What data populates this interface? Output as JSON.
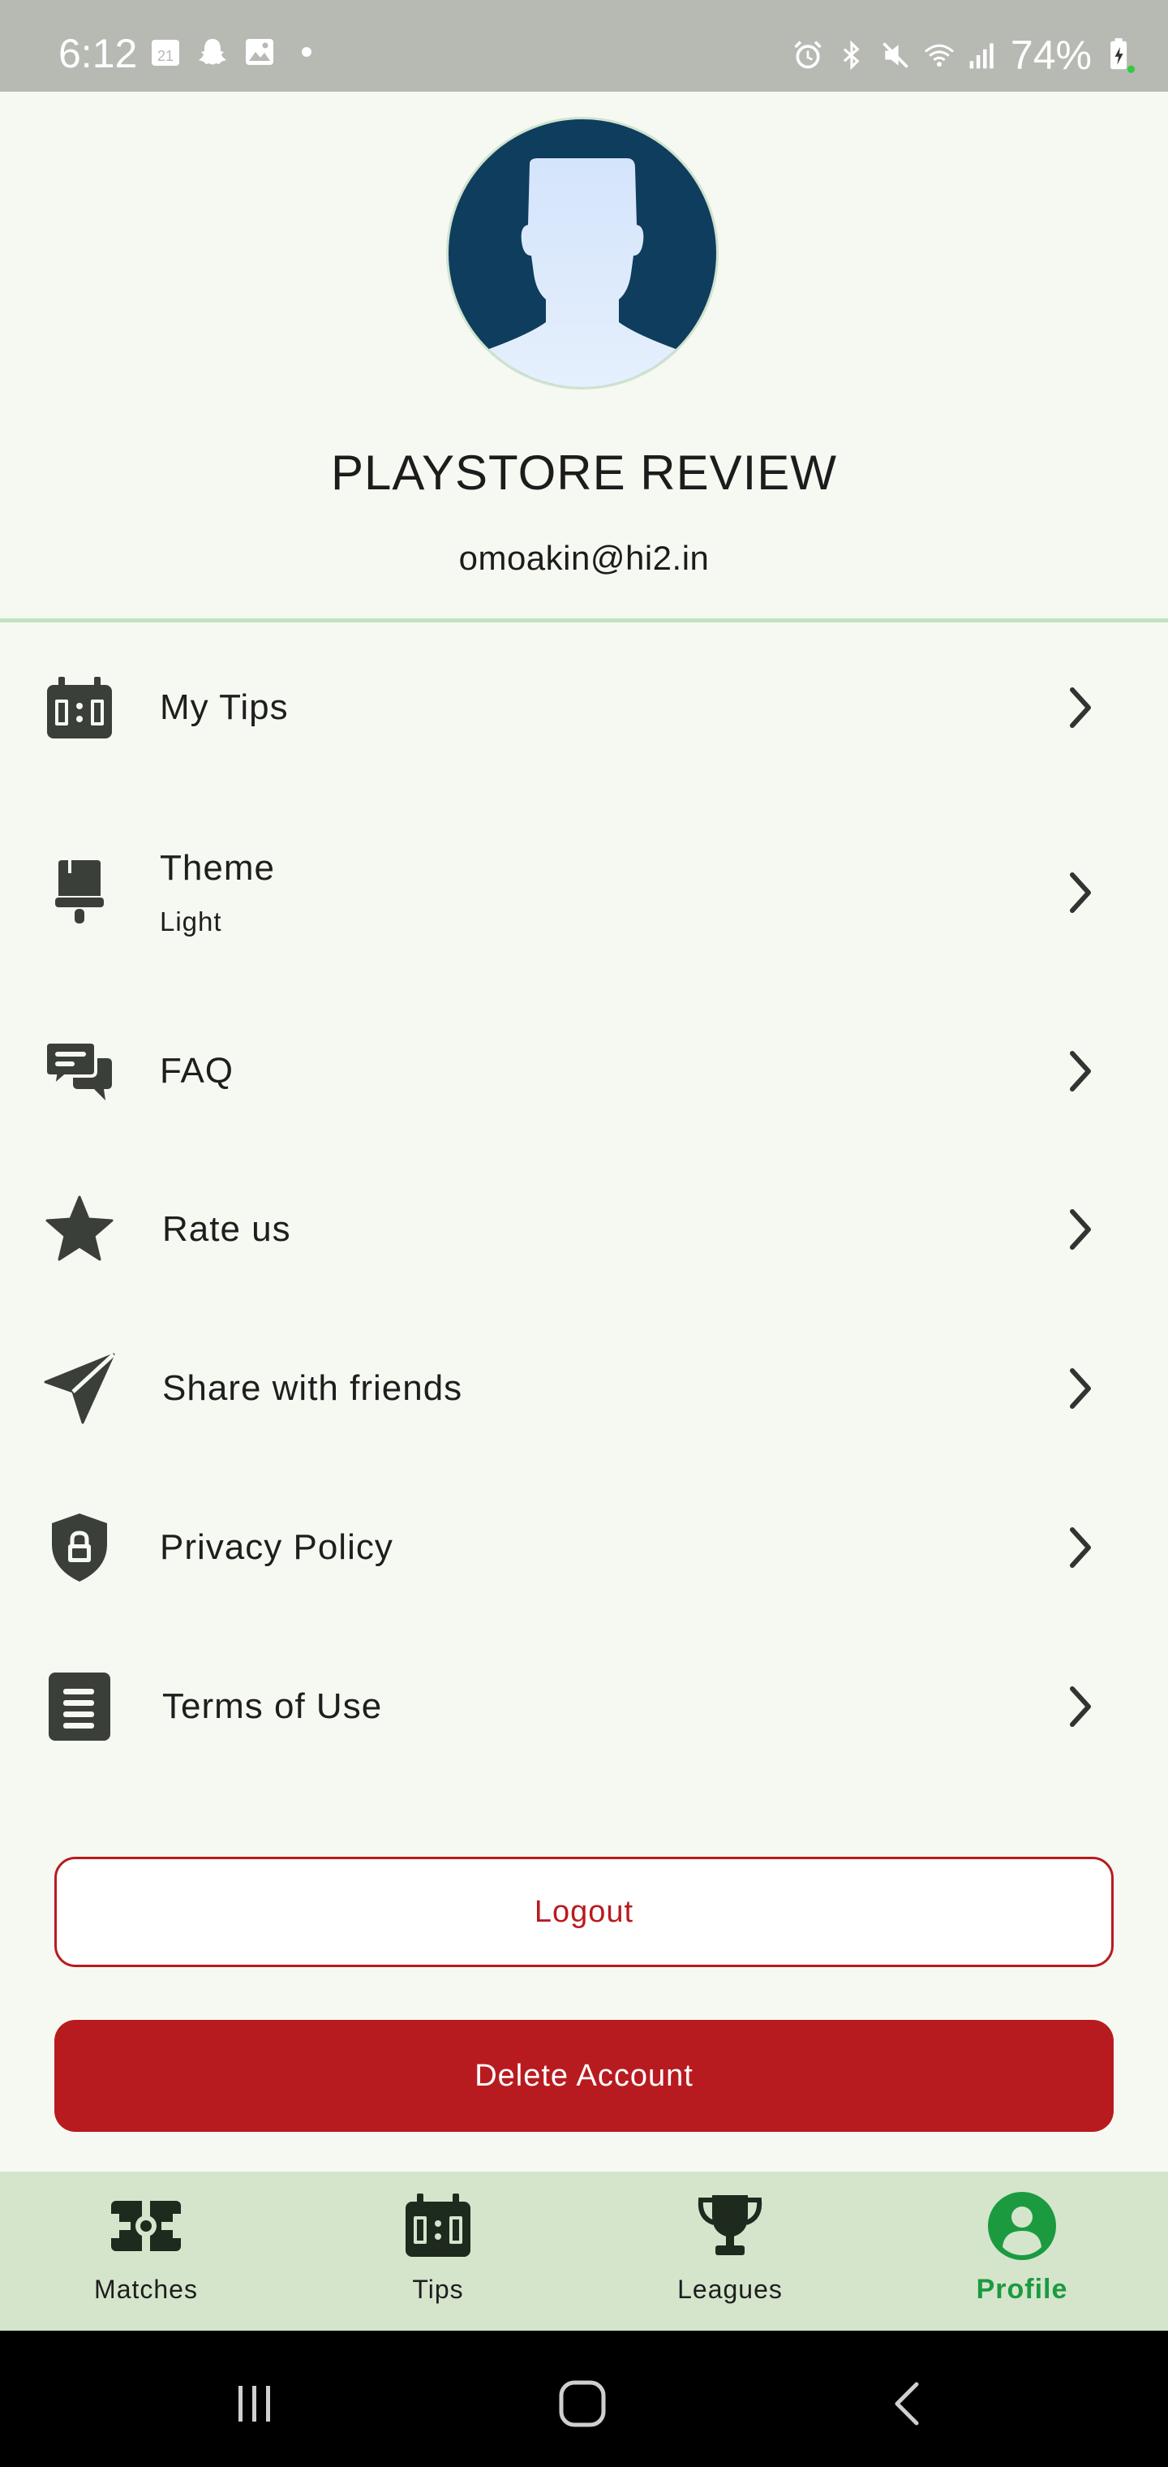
{
  "status_bar": {
    "time": "6:12",
    "calendar_day": "21",
    "battery_percent": "74%",
    "left_icons": [
      "calendar-icon",
      "snapchat-icon",
      "gallery-icon",
      "notification-dot-icon"
    ],
    "right_icons": [
      "alarm-icon",
      "bluetooth-icon",
      "mute-icon",
      "wifi-icon",
      "signal-icon",
      "battery-icon"
    ]
  },
  "profile": {
    "name": "PLAYSTORE REVIEW",
    "email": "omoakin@hi2.in",
    "avatar_icon": "avatar-placeholder-icon"
  },
  "menu": {
    "items": [
      {
        "label": "My Tips",
        "icon": "scoreboard-icon"
      },
      {
        "label": "Theme",
        "sublabel": "Light",
        "icon": "paint-brush-icon"
      },
      {
        "label": "FAQ",
        "icon": "chat-bubbles-icon"
      },
      {
        "label": "Rate us",
        "icon": "star-icon"
      },
      {
        "label": "Share with friends",
        "icon": "paper-plane-icon"
      },
      {
        "label": "Privacy Policy",
        "icon": "shield-lock-icon"
      },
      {
        "label": "Terms of Use",
        "icon": "document-icon"
      }
    ]
  },
  "buttons": {
    "logout": "Logout",
    "delete_account": "Delete Account"
  },
  "bottom_nav": {
    "items": [
      {
        "label": "Matches",
        "icon": "pitch-icon",
        "active": false
      },
      {
        "label": "Tips",
        "icon": "scoreboard-icon",
        "active": false
      },
      {
        "label": "Leagues",
        "icon": "trophy-icon",
        "active": false
      },
      {
        "label": "Profile",
        "icon": "profile-icon",
        "active": true
      }
    ]
  },
  "system_nav": [
    "recents-icon",
    "home-icon",
    "back-icon"
  ],
  "colors": {
    "background": "#f6f9f1",
    "status_bar": "#b7b9b3",
    "accent_red": "#b81b1f",
    "accent_green": "#1c9a40",
    "nav_background": "#d4e5cc",
    "divider": "#bfe4bf",
    "icon_dark": "#3a3f3a",
    "avatar_bg": "#0f3d5e"
  }
}
